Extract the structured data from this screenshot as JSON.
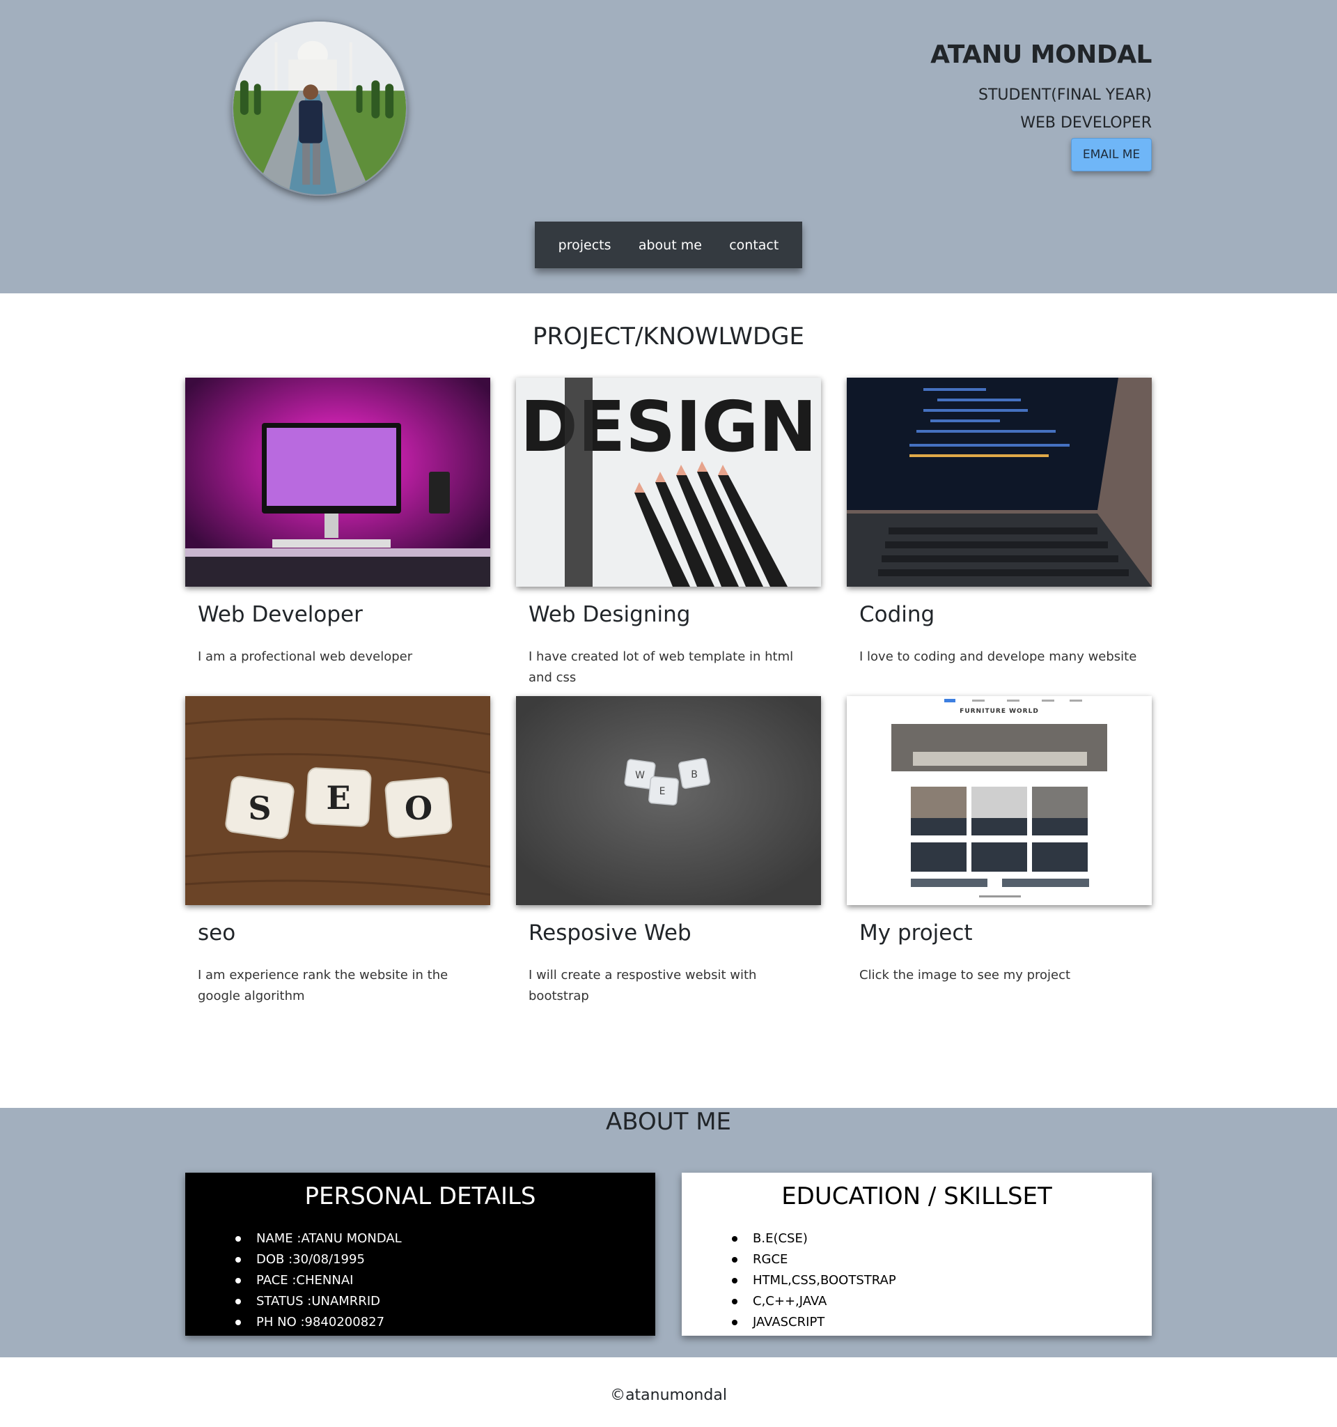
{
  "header": {
    "name": "ATANU MONDAL",
    "role1": "STUDENT(FINAL YEAR)",
    "role2": "WEB DEVELOPER",
    "email_label": "EMAIL ME"
  },
  "nav": {
    "items": [
      {
        "label": "projects"
      },
      {
        "label": "about me"
      },
      {
        "label": "contact"
      }
    ]
  },
  "projects": {
    "title": "PROJECT/KNOWLWDGE",
    "cards": [
      {
        "title": "Web Developer",
        "desc": "I am a profectional web developer"
      },
      {
        "title": "Web Designing",
        "desc": "I have created lot of web template in html and css",
        "image_text": "DESIGN"
      },
      {
        "title": "Coding",
        "desc": "I love to coding and develope many website"
      },
      {
        "title": "seo",
        "desc": "I am experience rank the website in the google algorithm",
        "image_tiles": [
          "S",
          "E",
          "O"
        ]
      },
      {
        "title": "Resposive Web",
        "desc": "I will create a respostive websit with bootstrap",
        "image_tiles": [
          "W",
          "B",
          "E"
        ]
      },
      {
        "title": "My project",
        "desc": "Click the image to see my project",
        "image_text": "FURNITURE WORLD"
      }
    ]
  },
  "about": {
    "title": "ABOUT ME",
    "personal": {
      "title": "PERSONAL DETAILS",
      "items": [
        "NAME :ATANU MONDAL",
        "DOB :30/08/1995",
        "PACE :CHENNAI",
        "STATUS :UNAMRRID",
        "PH NO :9840200827"
      ]
    },
    "education": {
      "title": "EDUCATION / SKILLSET",
      "items": [
        "B.E(CSE)",
        "RGCE",
        "HTML,CSS,BOOTSTRAP",
        "C,C++,JAVA",
        "JAVASCRIPT"
      ]
    }
  },
  "footer": {
    "text": "©atanumondal"
  },
  "colors": {
    "header_bg": "#a2afbe",
    "nav_bg": "#343a40",
    "email_btn": "#6fb6f7"
  }
}
